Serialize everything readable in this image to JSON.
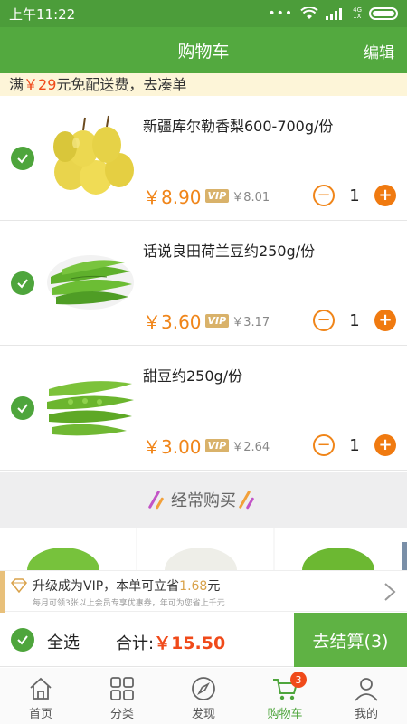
{
  "status_bar": {
    "time": "上午11:22",
    "network_top": "4G",
    "network_bottom": "1X"
  },
  "header": {
    "title": "购物车",
    "edit_label": "编辑"
  },
  "promo": {
    "prefix": "满",
    "amount": "￥29",
    "suffix": "元免配送费，去凑单"
  },
  "cart_items": [
    {
      "name": "新疆库尔勒香梨600-700g/份",
      "price": "￥8.90",
      "vip_label": "VIP",
      "vip_price": "￥8.01",
      "quantity": "1",
      "checked": true,
      "image": "pear-image"
    },
    {
      "name": "话说良田荷兰豆约250g/份",
      "price": "￥3.60",
      "vip_label": "VIP",
      "vip_price": "￥3.17",
      "quantity": "1",
      "checked": true,
      "image": "snow-pea-image"
    },
    {
      "name": "甜豆约250g/份",
      "price": "￥3.00",
      "vip_label": "VIP",
      "vip_price": "￥2.64",
      "quantity": "1",
      "checked": true,
      "image": "sugar-snap-pea-image"
    }
  ],
  "frequent": {
    "title": "经常购买"
  },
  "vip_upgrade": {
    "main_prefix": "升级成为VIP，本单可立省",
    "saving": "1.68",
    "main_suffix": "元",
    "sub": "每月可领3张以上会员专享优惠券，年可为您省上千元"
  },
  "checkout": {
    "select_all": "全选",
    "total_label": "合计:",
    "total_value": "￥15.50",
    "button_label": "去结算(3)"
  },
  "tabs": [
    {
      "label": "首页",
      "icon": "home-icon",
      "active": false
    },
    {
      "label": "分类",
      "icon": "category-icon",
      "active": false
    },
    {
      "label": "发现",
      "icon": "compass-icon",
      "active": false
    },
    {
      "label": "购物车",
      "icon": "cart-icon",
      "active": true,
      "badge": "3"
    },
    {
      "label": "我的",
      "icon": "profile-icon",
      "active": false
    }
  ],
  "colors": {
    "primary_green": "#53a93f",
    "accent_orange": "#f08519",
    "price_red": "#f04a1a",
    "vip_gold": "#d9b26a"
  }
}
